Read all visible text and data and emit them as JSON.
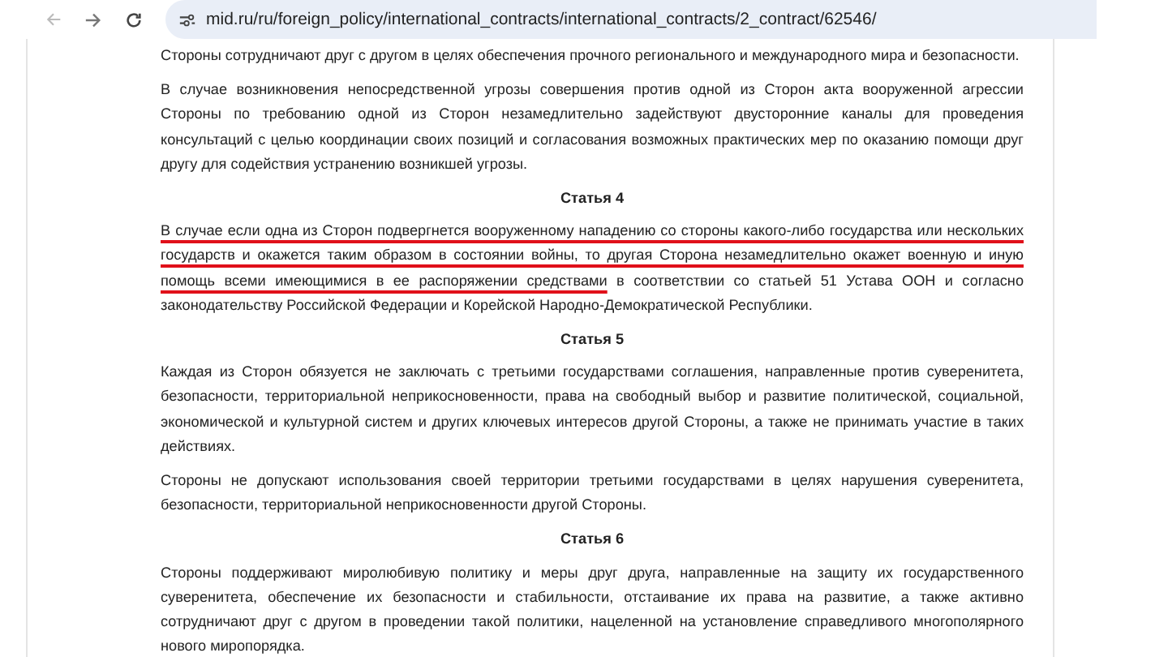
{
  "browser": {
    "url": "mid.ru/ru/foreign_policy/international_contracts/international_contracts/2_contract/62546/"
  },
  "blocks": [
    {
      "kind": "paragraph",
      "text": "Стороны сотрудничают друг с другом в целях обеспечения прочного регионального и международного мира и безопасности."
    },
    {
      "kind": "paragraph",
      "text": "В случае возникновения непосредственной угрозы совершения против одной из Сторон акта вооруженной агрессии Стороны по требованию одной из Сторон незамедлительно задействуют двусторонние каналы для проведения консультаций с целью координации своих позиций и согласования возможных практических мер по оказанию помощи друг другу для содействия устранению возникшей угрозы."
    },
    {
      "kind": "heading",
      "text": "Статья 4"
    },
    {
      "kind": "marked",
      "segments": [
        {
          "text": "В случае если одна из Сторон подвергнется вооруженному нападению со стороны какого-либо государства или нескольких государств и окажется таким образом в состоянии войны, то другая Сторона незамедлительно окажет военную и иную помощь всеми имеющимися в ее распоряжении средствами",
          "underlined": true
        },
        {
          "text": " в соответствии со статьей 51 Устава ООН и согласно законодательству Российской Федерации и Корейской Народно-Демократической Республики.",
          "underlined": false
        }
      ]
    },
    {
      "kind": "heading",
      "text": "Статья 5"
    },
    {
      "kind": "paragraph",
      "text": "Каждая из Сторон обязуется не заключать с третьими государствами соглашения, направленные против суверенитета, безопасности, территориальной неприкосновенности, права на свободный выбор и развитие политической, социальной, экономической и культурной систем и других ключевых интересов другой Стороны, а также не принимать участие в таких действиях."
    },
    {
      "kind": "paragraph",
      "text": "Стороны не допускают использования своей территории третьими государствами в целях нарушения суверенитета, безопасности, территориальной неприкосновенности другой Стороны."
    },
    {
      "kind": "heading",
      "text": "Статья 6"
    },
    {
      "kind": "paragraph",
      "text": "Стороны поддерживают миролюбивую политику и меры друг друга, направленные на защиту их государственного суверенитета, обеспечение их безопасности и стабильности, отстаивание их права на развитие, а также активно сотрудничают друг с другом в проведении такой политики, нацеленной на установление справедливого многополярного нового миропорядка."
    }
  ]
}
